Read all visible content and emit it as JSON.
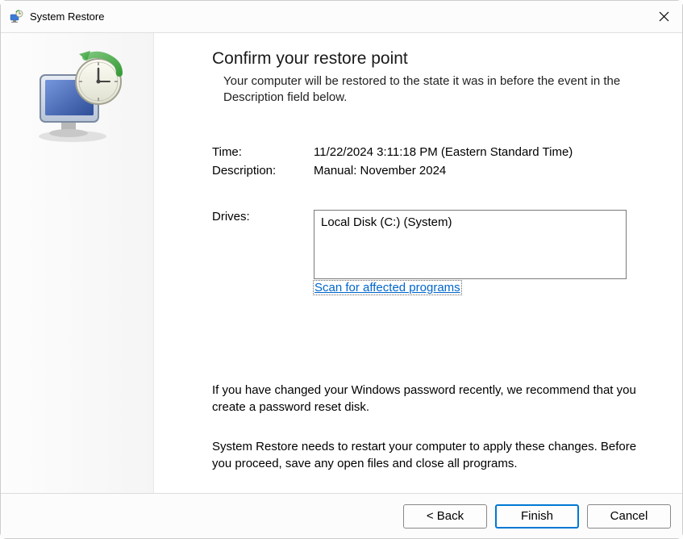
{
  "titlebar": {
    "title": "System Restore"
  },
  "header": {
    "title": "Confirm your restore point",
    "subtitle": "Your computer will be restored to the state it was in before the event in the Description field below."
  },
  "info": {
    "time_label": "Time:",
    "time_value": "11/22/2024 3:11:18 PM (Eastern Standard Time)",
    "description_label": "Description:",
    "description_value": "Manual: November 2024",
    "drives_label": "Drives:",
    "drives_value": "Local Disk (C:) (System)"
  },
  "links": {
    "scan": "Scan for affected programs"
  },
  "notices": {
    "password": "If you have changed your Windows password recently, we recommend that you create a password reset disk.",
    "restart": "System Restore needs to restart your computer to apply these changes. Before you proceed, save any open files and close all programs."
  },
  "buttons": {
    "back": "< Back",
    "finish": "Finish",
    "cancel": "Cancel"
  }
}
